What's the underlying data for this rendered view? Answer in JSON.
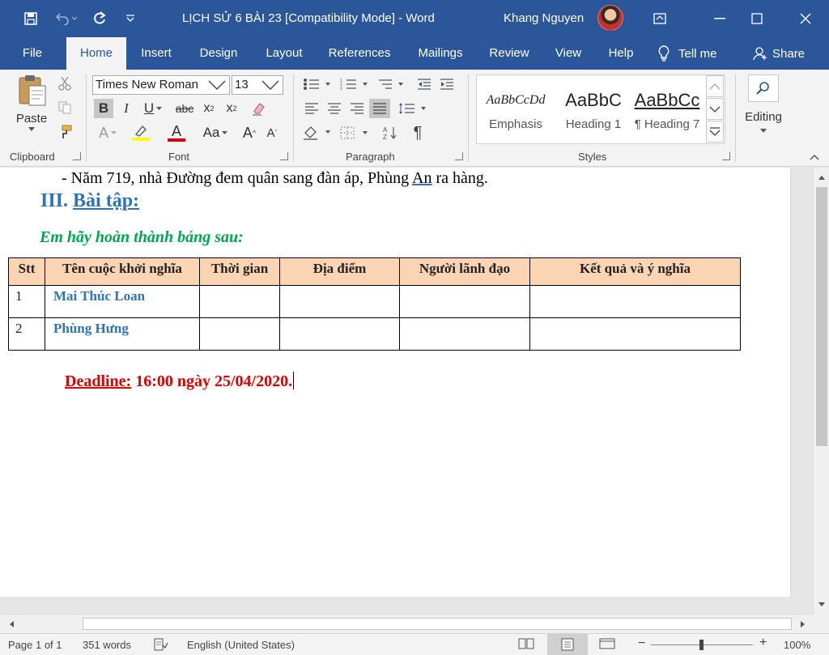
{
  "window": {
    "title": "LỊCH SỬ 6 BÀI 23 [Compatibility Mode]  -  Word",
    "user": "Khang Nguyen"
  },
  "tabs": [
    {
      "label": "File"
    },
    {
      "label": "Home",
      "active": true
    },
    {
      "label": "Insert"
    },
    {
      "label": "Design"
    },
    {
      "label": "Layout"
    },
    {
      "label": "References"
    },
    {
      "label": "Mailings"
    },
    {
      "label": "Review"
    },
    {
      "label": "View"
    },
    {
      "label": "Help"
    }
  ],
  "tell_me": "Tell me",
  "share": "Share",
  "ribbon": {
    "clipboard": {
      "label": "Clipboard",
      "paste": "Paste"
    },
    "font": {
      "label": "Font",
      "name": "Times New Roman",
      "size": "13"
    },
    "paragraph": {
      "label": "Paragraph"
    },
    "styles": {
      "label": "Styles",
      "items": [
        {
          "sample": "AaBbCcDd",
          "name": "Emphasis"
        },
        {
          "sample": "AaBbC",
          "name": "Heading 1"
        },
        {
          "sample": "AaBbCc",
          "name": "¶ Heading 7"
        }
      ]
    },
    "editing": {
      "label": "Editing"
    }
  },
  "document": {
    "line1_before": "- Năm 719, nhà Đường đem quân sang đàn áp, Phùng ",
    "line1_underlined": "An",
    "line1_after": " ra hàng.",
    "heading_num": "III. ",
    "heading_text": "Bài tập:",
    "instruction": "Em hãy hoàn thành bảng sau:",
    "table": {
      "headers": [
        "Stt",
        "Tên cuộc khởi nghĩa",
        "Thời gian",
        "Địa điểm",
        "Người lãnh đạo",
        "Kết quả và ý nghĩa"
      ],
      "rows": [
        [
          "1",
          "Mai Thúc Loan",
          "",
          "",
          "",
          ""
        ],
        [
          "2",
          "Phùng Hưng",
          "",
          "",
          "",
          ""
        ]
      ]
    },
    "deadline_label": "Deadline:",
    "deadline_value": " 16:00 ngày 25/04/2020."
  },
  "status": {
    "page": "Page 1 of 1",
    "words": "351 words",
    "language": "English (United States)",
    "zoom": "100%"
  },
  "colors": {
    "accent": "#2b579a",
    "heading": "#2e74b5",
    "instruction": "#00a650",
    "deadline": "#e00000",
    "table_header": "#fbd4b4"
  }
}
